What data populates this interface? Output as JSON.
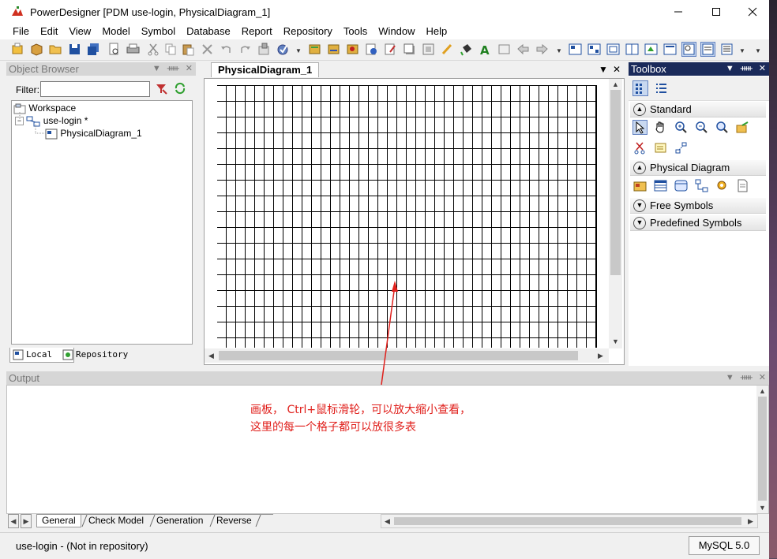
{
  "window": {
    "title": "PowerDesigner [PDM use-login, PhysicalDiagram_1]"
  },
  "menu": [
    "File",
    "Edit",
    "View",
    "Model",
    "Symbol",
    "Database",
    "Report",
    "Repository",
    "Tools",
    "Window",
    "Help"
  ],
  "object_browser": {
    "title": "Object Browser",
    "filter_label": "Filter:",
    "filter_value": "",
    "tree": {
      "workspace": "Workspace",
      "model": "use-login",
      "model_mark": "*",
      "diagram": "PhysicalDiagram_1"
    },
    "tabs": [
      "Local",
      "Repository"
    ]
  },
  "diagram": {
    "tab_label": "PhysicalDiagram_1"
  },
  "toolbox": {
    "title": "Toolbox",
    "groups": [
      "Standard",
      "Physical Diagram",
      "Free Symbols",
      "Predefined Symbols"
    ]
  },
  "output": {
    "title": "Output",
    "annotation_line1": "画板， Ctrl+鼠标滑轮，可以放大缩小查看，",
    "annotation_line2": "这里的每一个格子都可以放很多表",
    "annotation_color": "#e0201c",
    "tabs": [
      "General",
      "Check Model",
      "Generation",
      "Reverse"
    ]
  },
  "status": {
    "text": "use-login - (Not in repository)",
    "database": "MySQL 5.0"
  }
}
